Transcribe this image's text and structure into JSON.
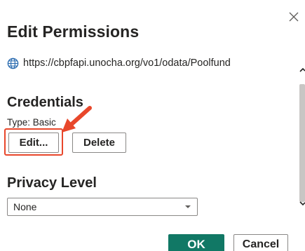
{
  "dialog": {
    "title": "Edit Permissions",
    "url": "https://cbpfapi.unocha.org/vo1/odata/Poolfund"
  },
  "credentials": {
    "heading": "Credentials",
    "type_label": "Type: Basic",
    "edit_label": "Edit...",
    "delete_label": "Delete"
  },
  "privacy": {
    "heading": "Privacy Level",
    "selected": "None"
  },
  "footer": {
    "ok_label": "OK",
    "cancel_label": "Cancel"
  },
  "colors": {
    "ok_button": "#117865",
    "highlight": "#e8472b",
    "globe_icon": "#2b6cb0"
  },
  "icons": {
    "close": "close-icon",
    "globe": "globe-icon",
    "chevron": "chevron-down-icon",
    "annotation": "arrow-icon"
  }
}
